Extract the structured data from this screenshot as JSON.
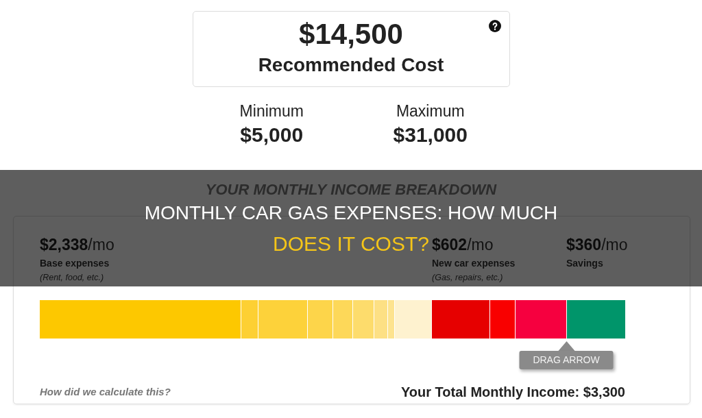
{
  "summary": {
    "amount": "$14,500",
    "label": "Recommended Cost"
  },
  "range": [
    {
      "label": "Minimum",
      "amount": "$5,000"
    },
    {
      "label": "Maximum",
      "amount": "$31,000"
    }
  ],
  "breakdown": {
    "title": "YOUR MONTHLY INCOME BREAKDOWN",
    "groups": [
      {
        "amount": "**$2,338**/mo",
        "label": "Base expenses",
        "note": "(Rent, food, etc.)"
      },
      {
        "amount": "**$602**/mo",
        "label": "New car expenses",
        "note": "(Gas, repairs, etc.)"
      },
      {
        "amount": "**$360**/mo",
        "label": "Savings"
      }
    ],
    "tooltip": "DRAG ARROW",
    "link": "How did we calculate this?",
    "total": "Your Total Monthly Income: $3,300"
  },
  "banner": {
    "lines": [
      {
        "text": "MONTHLY CAR GAS EXPENSES: HOW MUCH",
        "kind": "plain"
      },
      {
        "text": "DOES IT COST?",
        "kind": "accent"
      }
    ]
  }
}
